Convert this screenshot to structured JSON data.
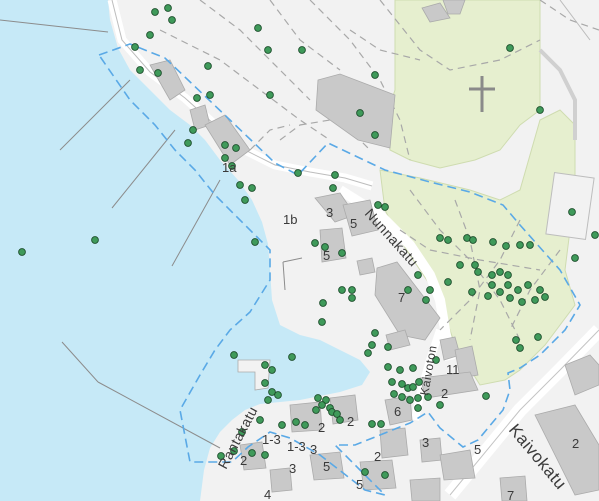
{
  "map": {
    "colors": {
      "water": "#c6e9f7",
      "land": "#f2f2f2",
      "park": "#e6efcf",
      "building": "#c9c9c9",
      "tree": "#3f9a5a",
      "boundary": "#5aa9e6",
      "path": "#9a9a9a"
    },
    "symbols": {
      "cemetery": "cross-icon",
      "tree": "tree-point"
    },
    "streets": [
      {
        "name": "Nunnakatu"
      },
      {
        "name": "Kaivokatu"
      },
      {
        "name": "Kaivoton"
      },
      {
        "name": "Rantakatu"
      }
    ],
    "house_numbers": [
      "1a",
      "1b",
      "3",
      "5",
      "5",
      "7",
      "11",
      "2",
      "6",
      "2",
      "2",
      "1-3",
      "1-3",
      "3",
      "5",
      "3",
      "2",
      "5",
      "3",
      "2",
      "2",
      "7",
      "4",
      "5"
    ]
  }
}
